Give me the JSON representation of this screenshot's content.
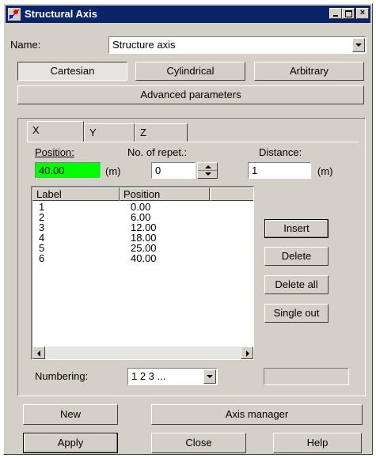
{
  "window": {
    "title": "Structural Axis"
  },
  "name_row": {
    "label": "Name:",
    "value": "Structure axis"
  },
  "coord_buttons": [
    "Cartesian",
    "Cylindrical",
    "Arbitrary"
  ],
  "advanced_label": "Advanced parameters",
  "tabs": [
    "X",
    "Y",
    "Z"
  ],
  "fields": {
    "position_label": "Position:",
    "position_value": "40.00",
    "position_unit": "(m)",
    "repet_label": "No. of repet.:",
    "repet_value": "0",
    "distance_label": "Distance:",
    "distance_value": "1",
    "distance_unit": "(m)"
  },
  "table": {
    "headers": [
      "Label",
      "Position"
    ],
    "rows": [
      {
        "label": "1",
        "position": "0.00"
      },
      {
        "label": "2",
        "position": "6.00"
      },
      {
        "label": "3",
        "position": "12.00"
      },
      {
        "label": "4",
        "position": "18.00"
      },
      {
        "label": "5",
        "position": "25.00"
      },
      {
        "label": "6",
        "position": "40.00"
      }
    ]
  },
  "side_buttons": [
    "Insert",
    "Delete",
    "Delete all",
    "Single out"
  ],
  "numbering": {
    "label": "Numbering:",
    "value": "1 2 3 ..."
  },
  "bottom": {
    "new": "New",
    "axis_manager": "Axis manager",
    "apply": "Apply",
    "close": "Close",
    "help": "Help"
  },
  "colors": {
    "title_bar": "#0a246a",
    "position_field": "#00ff00",
    "face": "#d4d0c8"
  }
}
